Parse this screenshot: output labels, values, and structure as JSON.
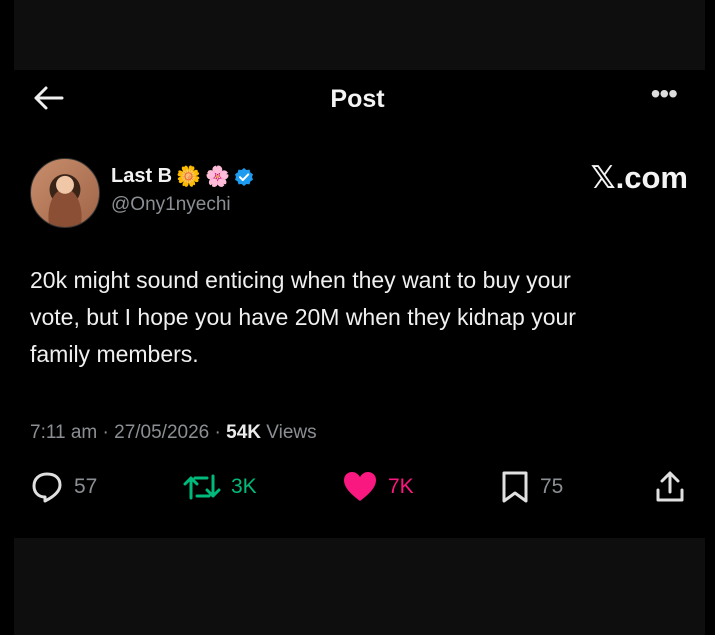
{
  "header": {
    "title": "Post"
  },
  "author": {
    "name": "Last B",
    "badges": [
      "🌼",
      "🌸"
    ],
    "handle": "@Ony1nyechi"
  },
  "brand": "𝕏.com",
  "tweet": {
    "lines": [
      "20k might sound enticing when they want to buy your",
      "vote, but I hope you have 20M when they kidnap your",
      "family members."
    ]
  },
  "meta": {
    "time": "7:11 am",
    "date": "27/05/2026",
    "views_count": "54K",
    "views_label": "Views",
    "sep": "·"
  },
  "actions": {
    "replies": "57",
    "reposts": "3K",
    "likes": "7K",
    "bookmarks": "75"
  },
  "colors": {
    "repost": "#00ba7c",
    "like": "#f91880",
    "verified": "#1d9bf0",
    "muted": "#8b8f93"
  }
}
